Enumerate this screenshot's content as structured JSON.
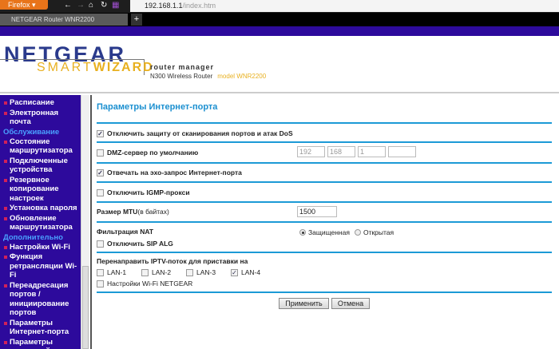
{
  "browser": {
    "menu": "Firefox",
    "url_host": "192.168.1.1",
    "url_path": "/index.htm",
    "tab_title": "NETGEAR Router WNR2200",
    "new_tab": "+"
  },
  "header": {
    "logo_top": "NETGEAR",
    "logo_smart": "SMART",
    "logo_wizard": "WIZARD",
    "router_manager": "router manager",
    "device": "N300 Wireless Router",
    "model": "model WNR2200"
  },
  "sidebar": {
    "items": [
      {
        "type": "item",
        "label": "Расписание"
      },
      {
        "type": "item",
        "label": "Электронная почта"
      },
      {
        "type": "heading",
        "label": "Обслуживание"
      },
      {
        "type": "item",
        "label": "Состояние маршрутизатора"
      },
      {
        "type": "item",
        "label": "Подключенные устройства"
      },
      {
        "type": "item",
        "label": "Резервное копирование настроек"
      },
      {
        "type": "item",
        "label": "Установка пароля"
      },
      {
        "type": "item",
        "label": "Обновление маршрутизатора"
      },
      {
        "type": "heading",
        "label": "Дополнительно"
      },
      {
        "type": "item",
        "label": "Настройки Wi-Fi"
      },
      {
        "type": "item",
        "label": "Функция ретрансляции Wi-Fi"
      },
      {
        "type": "item",
        "label": "Переадресация портов / инициирование портов"
      },
      {
        "type": "item",
        "label": "Параметры Интернет-порта"
      },
      {
        "type": "item",
        "label": "Параметры локальной сети"
      }
    ]
  },
  "main": {
    "title": "Параметры Интернет-порта",
    "dos": {
      "label": "Отключить защиту от сканирования портов и атак DoS",
      "checked": true
    },
    "dmz": {
      "label": "DMZ-сервер по умолчанию",
      "checked": false,
      "ip": [
        "192",
        "168",
        "1",
        ""
      ]
    },
    "ping": {
      "label": "Отвечать на эхо-запрос Интернет-порта",
      "checked": true
    },
    "igmp": {
      "label": "Отключить IGMP-прокси",
      "checked": false
    },
    "mtu": {
      "label": "Размер MTU",
      "unit": "(в байтах)",
      "value": "1500"
    },
    "nat": {
      "label": "Фильтрация NAT",
      "secured": "Защищенная",
      "open": "Открытая",
      "selected": "secured"
    },
    "sip": {
      "label": "Отключить SIP ALG",
      "checked": false
    },
    "iptv": {
      "label": "Перенаправить IPTV-поток для приставки на",
      "lans": [
        {
          "label": "LAN-1",
          "checked": false
        },
        {
          "label": "LAN-2",
          "checked": false
        },
        {
          "label": "LAN-3",
          "checked": false
        },
        {
          "label": "LAN-4",
          "checked": true
        }
      ],
      "wifi": {
        "label": "Настройки Wi-Fi NETGEAR",
        "checked": false
      }
    },
    "apply": "Применить",
    "cancel": "Отмена"
  }
}
